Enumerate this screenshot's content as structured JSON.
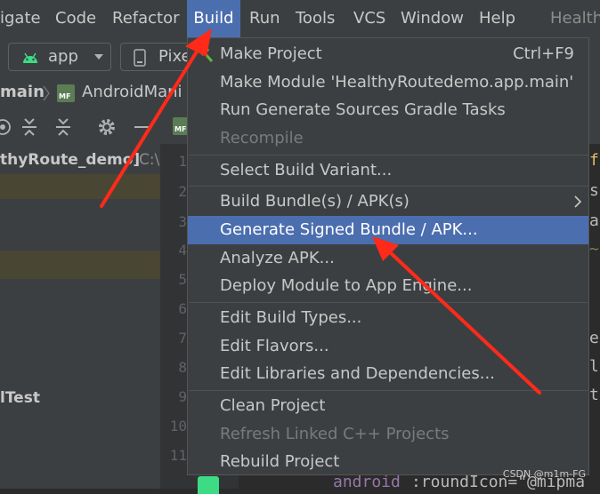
{
  "menubar": {
    "items": [
      {
        "label": "igate"
      },
      {
        "label": "Code"
      },
      {
        "label": "Refactor"
      },
      {
        "label": "Build"
      },
      {
        "label": "Run"
      },
      {
        "label": "Tools"
      },
      {
        "label": "VCS"
      },
      {
        "label": "Window"
      },
      {
        "label": "Help"
      }
    ],
    "title_fragment": "Health"
  },
  "toolbar": {
    "run_config": "app",
    "device": "Pixe"
  },
  "breadcrumb": {
    "module": "main",
    "file": "AndroidMani",
    "file_badge": "MF"
  },
  "editor": {
    "tab_badge": "MF",
    "line_numbers": [
      "1",
      "2",
      "3",
      "4",
      "5",
      "6",
      "7",
      "8",
      "9",
      "10",
      "11"
    ],
    "code_bottom_attr": "android",
    "code_bottom_rest": ":roundIcon=\"@mipma",
    "code_right_chars": [
      "f",
      "s",
      "a",
      "~",
      "e",
      "l",
      "t"
    ]
  },
  "project_tree": {
    "root": "thyRoute_demo]",
    "root_path": "C:\\",
    "item_test": "lTest"
  },
  "build_menu": {
    "items": [
      {
        "label": "Make Project",
        "shortcut": "Ctrl+F9"
      },
      {
        "label": "Make Module 'HealthyRoutedemo.app.main'"
      },
      {
        "label": "Run Generate Sources Gradle Tasks"
      },
      {
        "label": "Recompile"
      },
      {
        "label": "Select Build Variant..."
      },
      {
        "label": "Build Bundle(s) / APK(s)"
      },
      {
        "label": "Generate Signed Bundle / APK..."
      },
      {
        "label": "Analyze APK..."
      },
      {
        "label": "Deploy Module to App Engine..."
      },
      {
        "label": "Edit Build Types..."
      },
      {
        "label": "Edit Flavors..."
      },
      {
        "label": "Edit Libraries and Dependencies..."
      },
      {
        "label": "Clean Project"
      },
      {
        "label": "Refresh Linked C++ Projects"
      },
      {
        "label": "Rebuild Project"
      }
    ]
  },
  "watermark": "CSDN @m1m-FG",
  "colors": {
    "accent": "#4b6eaf",
    "arrow": "#ff2a1a",
    "android_green": "#3ddc84"
  }
}
